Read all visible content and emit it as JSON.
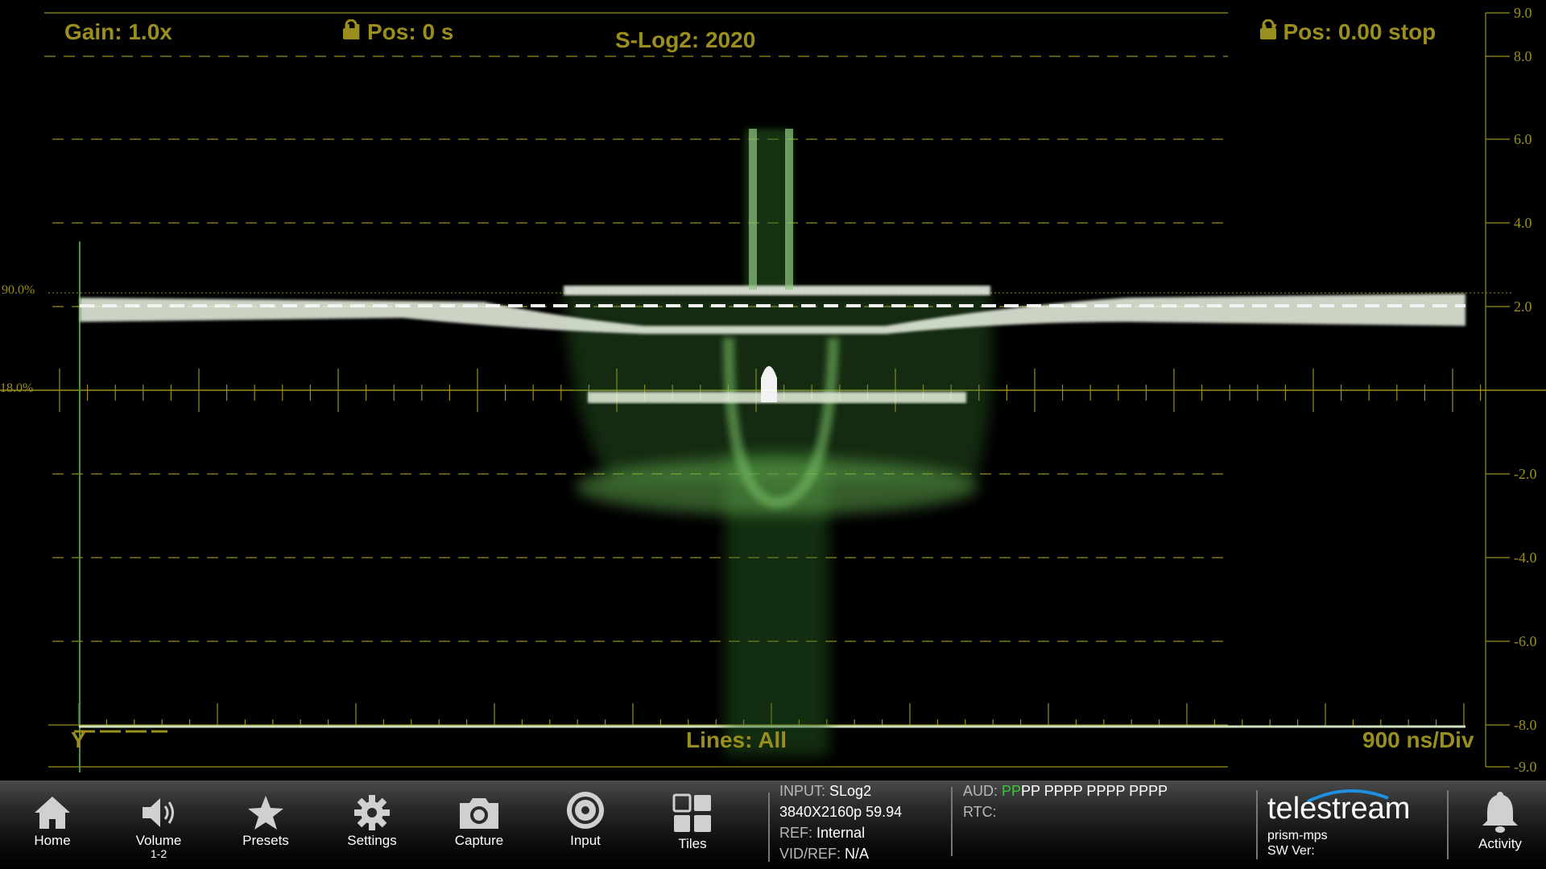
{
  "scope": {
    "gain": "Gain: 1.0x",
    "h_pos": "H Pos: 0 s",
    "v_pos": "V Pos: 0.00 stop",
    "title": "S-Log2: 2020",
    "lines": "Lines: All",
    "timebase": "900 ns/Div",
    "trace_label": "Y",
    "left_marks": [
      "90.0%",
      "18.0%"
    ],
    "right_scale": [
      "9.0",
      "8.0",
      "6.0",
      "4.0",
      "2.0",
      "-2.0",
      "-4.0",
      "-6.0",
      "-8.0",
      "-9.0"
    ],
    "colors": {
      "graticule": "#9a8f1e",
      "trace": "#6fbf5a",
      "trace_hot": "#ffffff"
    }
  },
  "toolbar": {
    "buttons": [
      {
        "label": "Home",
        "icon": "home-icon"
      },
      {
        "label": "Volume",
        "sub": "1-2",
        "icon": "speaker-icon"
      },
      {
        "label": "Presets",
        "icon": "star-icon"
      },
      {
        "label": "Settings",
        "icon": "gear-icon"
      },
      {
        "label": "Capture",
        "icon": "camera-icon"
      },
      {
        "label": "Input",
        "icon": "input-target-icon"
      },
      {
        "label": "Tiles",
        "icon": "tiles-icon"
      }
    ],
    "input_label": "INPUT:",
    "input_value": "SLog2",
    "format": "3840X2160p 59.94",
    "ref_label": "REF:",
    "ref_value": "Internal",
    "vidref_label": "VID/REF:",
    "vidref_value": "N/A",
    "aud_label": "AUD:",
    "aud_active": "PP",
    "aud_rest": "PP PPPP PPPP PPPP",
    "rtc_label": "RTC:",
    "brand": "telestream",
    "device": "prism-mps",
    "sw_ver_label": "SW Ver:",
    "activity": "Activity"
  }
}
